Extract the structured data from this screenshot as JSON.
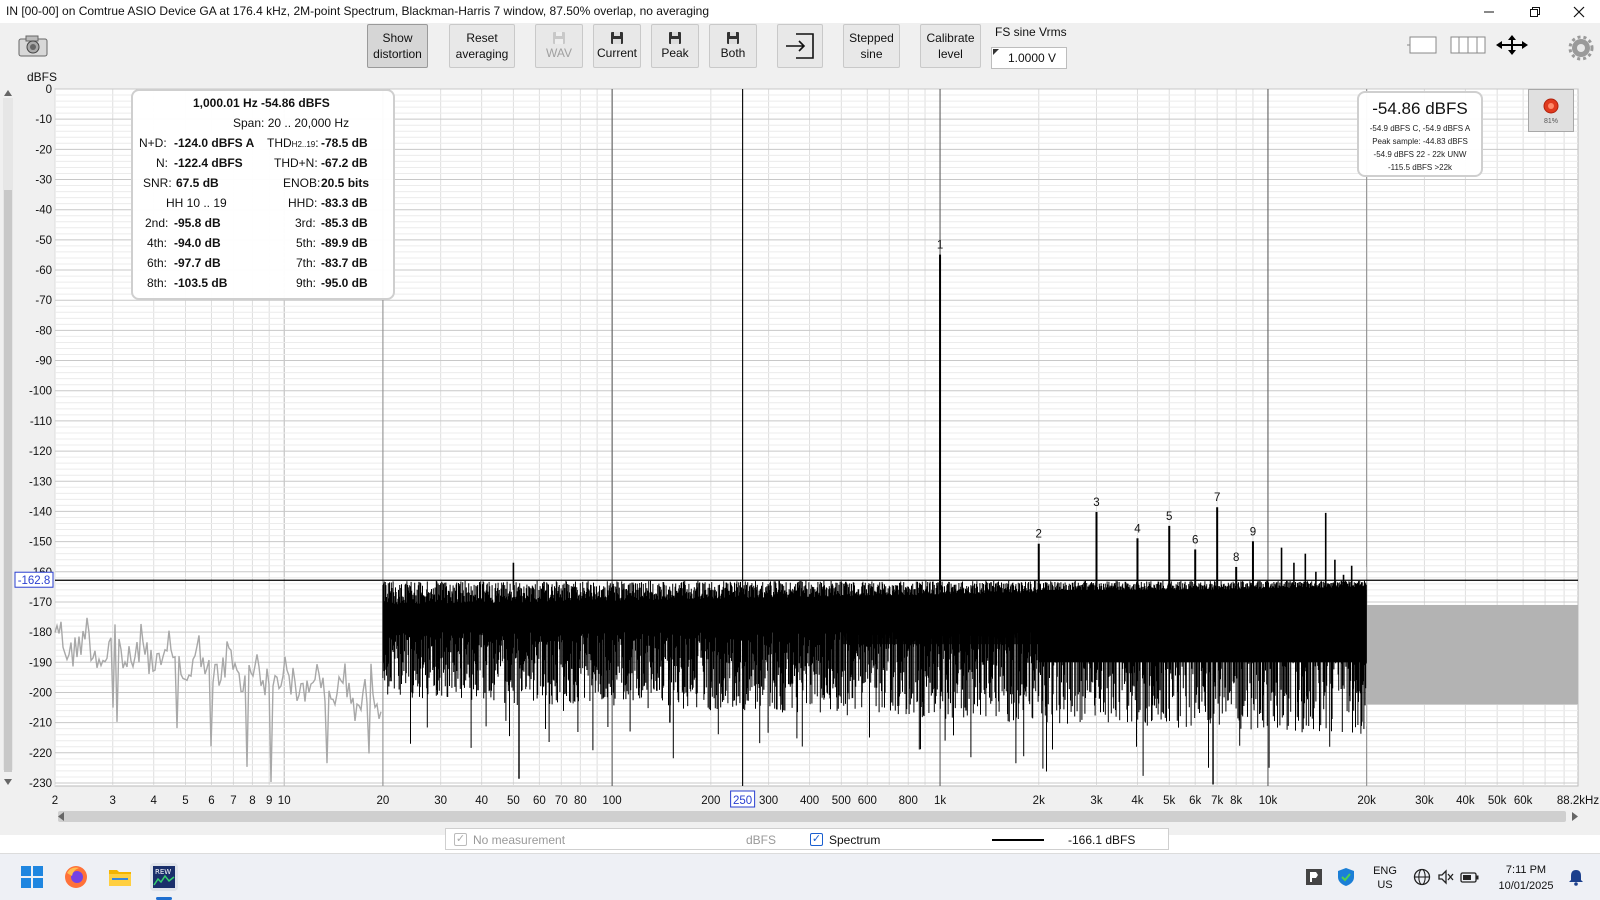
{
  "window": {
    "title": "IN [00-00] on Comtrue ASIO Device GA at 176.4 kHz, 2M-point Spectrum, Blackman-Harris 7 window, 87.50% overlap, no averaging"
  },
  "toolbar": {
    "show_distortion_l1": "Show",
    "show_distortion_l2": "distortion",
    "reset_averaging_l1": "Reset",
    "reset_averaging_l2": "averaging",
    "wav": "WAV",
    "current": "Current",
    "peak": "Peak",
    "both": "Both",
    "stepped_sine_l1": "Stepped",
    "stepped_sine_l2": "sine",
    "calibrate_level_l1": "Calibrate",
    "calibrate_level_l2": "level",
    "fs_sine_label": "FS sine Vrms",
    "fs_sine_value": "1.0000 V"
  },
  "stats": {
    "fundamental": "1,000.01 Hz -54.86 dBFS",
    "span": "Span: 20 .. 20,000 Hz",
    "nd_label": "N+D:",
    "nd_value": "-124.0 dBFS A",
    "thd_label": "THD",
    "thd_sub": "H2..19",
    "thd_colon": ":",
    "thd_value": "-78.5 dB",
    "n_label": "N:",
    "n_value": "-122.4 dBFS",
    "thdn_label": "THD+N:",
    "thdn_value": "-67.2 dB",
    "snr_label": "SNR:",
    "snr_value": "67.5 dB",
    "enob_label": "ENOB:",
    "enob_value": "20.5 bits",
    "hh_label": "HH 10 .. 19",
    "hhd_label": "HHD:",
    "hhd_value": "-83.3 dB",
    "h2_label": "2nd:",
    "h2_value": "-95.8 dB",
    "h3_label": "3rd:",
    "h3_value": "-85.3 dB",
    "h4_label": "4th:",
    "h4_value": "-94.0 dB",
    "h5_label": "5th:",
    "h5_value": "-89.9 dB",
    "h6_label": "6th:",
    "h6_value": "-97.7 dB",
    "h7_label": "7th:",
    "h7_value": "-83.7 dB",
    "h8_label": "8th:",
    "h8_value": "-103.5 dB",
    "h9_label": "9th:",
    "h9_value": "-95.0 dB"
  },
  "level": {
    "main": "-54.86 dBFS",
    "line1": "-54.9 dBFS C, -54.9 dBFS A",
    "line2": "Peak sample: -44.83 dBFS",
    "line3": "-54.9 dBFS 22 - 22k UNW",
    "line4": "-115.5 dBFS >22k",
    "record_percent": "81%"
  },
  "legend": {
    "no_measurement": "No measurement",
    "units": "dBFS",
    "spectrum": "Spectrum",
    "spectrum_value": "-166.1 dBFS"
  },
  "taskbar": {
    "lang1": "ENG",
    "lang2": "US",
    "time": "7:11 PM",
    "date": "10/01/2025"
  },
  "chart_data": {
    "type": "line",
    "ylabel": "dBFS",
    "ylim": [
      -235,
      0
    ],
    "x_scale": "log",
    "xlim": [
      2,
      88200
    ],
    "y_ticks": [
      0,
      -10,
      -20,
      -30,
      -40,
      -50,
      -60,
      -70,
      -80,
      -90,
      -100,
      -110,
      -120,
      -130,
      -140,
      -150,
      -160,
      -170,
      -180,
      -190,
      -200,
      -210,
      -220,
      -230
    ],
    "x_ticks": [
      {
        "v": 2,
        "t": "2"
      },
      {
        "v": 3,
        "t": "3"
      },
      {
        "v": 4,
        "t": "4"
      },
      {
        "v": 5,
        "t": "5"
      },
      {
        "v": 6,
        "t": "6"
      },
      {
        "v": 7,
        "t": "7"
      },
      {
        "v": 8,
        "t": "8"
      },
      {
        "v": 9,
        "t": "9"
      },
      {
        "v": 10,
        "t": "10"
      },
      {
        "v": 20,
        "t": "20"
      },
      {
        "v": 30,
        "t": "30"
      },
      {
        "v": 40,
        "t": "40"
      },
      {
        "v": 50,
        "t": "50"
      },
      {
        "v": 60,
        "t": "60"
      },
      {
        "v": 70,
        "t": "70"
      },
      {
        "v": 80,
        "t": "80"
      },
      {
        "v": 100,
        "t": "100"
      },
      {
        "v": 200,
        "t": "200"
      },
      {
        "v": 250,
        "t": "250"
      },
      {
        "v": 300,
        "t": "300"
      },
      {
        "v": 400,
        "t": "400"
      },
      {
        "v": 500,
        "t": "500"
      },
      {
        "v": 600,
        "t": "600"
      },
      {
        "v": 800,
        "t": "800"
      },
      {
        "v": 1000,
        "t": "1k"
      },
      {
        "v": 2000,
        "t": "2k"
      },
      {
        "v": 3000,
        "t": "3k"
      },
      {
        "v": 4000,
        "t": "4k"
      },
      {
        "v": 5000,
        "t": "5k"
      },
      {
        "v": 6000,
        "t": "6k"
      },
      {
        "v": 7000,
        "t": "7k"
      },
      {
        "v": 8000,
        "t": "8k"
      },
      {
        "v": 10000,
        "t": "10k"
      },
      {
        "v": 20000,
        "t": "20k"
      },
      {
        "v": 30000,
        "t": "30k"
      },
      {
        "v": 40000,
        "t": "40k"
      },
      {
        "v": 50000,
        "t": "50k"
      },
      {
        "v": 60000,
        "t": "60k"
      },
      {
        "v": 88200,
        "t": "88.2kHz"
      }
    ],
    "cursor_x": {
      "v": 250,
      "t": "250"
    },
    "cursor_y": {
      "v": -162.8,
      "t": "-162.8"
    },
    "analysis_band_hz": [
      20,
      20000
    ],
    "series": [
      {
        "name": "Spectrum",
        "color": "#000000",
        "noise_floor_dbfs": [
          -165,
          -228
        ],
        "peaks": [
          {
            "label": "1",
            "hz": 1000,
            "dbfs": -54.9
          },
          {
            "label": "2",
            "hz": 2000,
            "dbfs": -150.7
          },
          {
            "label": "3",
            "hz": 3000,
            "dbfs": -140.2
          },
          {
            "label": "4",
            "hz": 4000,
            "dbfs": -148.9
          },
          {
            "label": "5",
            "hz": 5000,
            "dbfs": -144.8
          },
          {
            "label": "6",
            "hz": 6000,
            "dbfs": -152.6
          },
          {
            "label": "7",
            "hz": 7000,
            "dbfs": -138.6
          },
          {
            "label": "8",
            "hz": 8000,
            "dbfs": -158.4
          },
          {
            "label": "9",
            "hz": 9000,
            "dbfs": -149.9
          }
        ]
      }
    ],
    "grid": true
  }
}
